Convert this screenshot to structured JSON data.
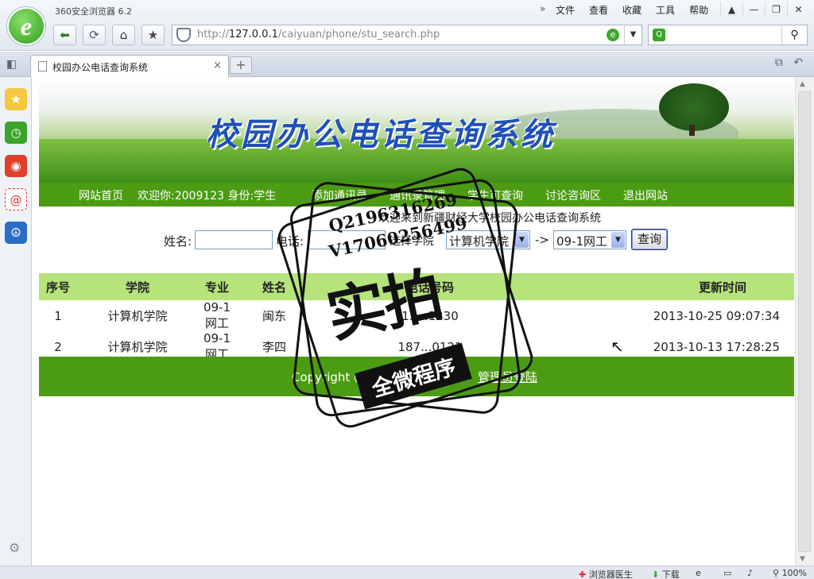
{
  "browser": {
    "app_title": "360安全浏览器 6.2",
    "logo_letter": "e",
    "menu": {
      "chevron": "»",
      "items": [
        "文件",
        "查看",
        "收藏",
        "工具",
        "帮助"
      ]
    },
    "window_buttons": [
      "▲",
      "—",
      "❐",
      "✕"
    ],
    "address": {
      "url_prefix": "http://",
      "url_host": "127.0.0.1",
      "url_path": "/caiyuan/phone/stu_search.php"
    },
    "search": {
      "value": ""
    },
    "tab": {
      "title": "校园办公电话查询系统",
      "close": "×"
    },
    "new_tab": "+",
    "status": {
      "doctor": "浏览器医生",
      "download": "下载",
      "zoom": "100%"
    }
  },
  "site": {
    "banner_title": "校园办公电话查询系统",
    "nav": [
      {
        "label": "网站首页"
      },
      {
        "label": "欢迎你:2009123 身份:学生"
      },
      {
        "label": "添加通讯录"
      },
      {
        "label": "通讯录管理"
      },
      {
        "label": "学生可查询"
      },
      {
        "label": "讨论咨询区"
      },
      {
        "label": "退出网站"
      }
    ],
    "welcome": "欢迎来到新疆财经大学校园办公电话查询系统",
    "form": {
      "name_label": "姓名:",
      "name_value": "",
      "phone_label": "电话:",
      "phone_value": "",
      "college_label": "选择学院",
      "college_selected": "计算机学院",
      "arrow": "->",
      "class_selected": "09-1网工",
      "submit": "查询"
    },
    "table": {
      "headers": [
        "序号",
        "学院",
        "专业",
        "姓名",
        "电话号码",
        "更新时间"
      ],
      "rows": [
        [
          "1",
          "计算机学院",
          "09-1网工",
          "闽东",
          "13...1230",
          "2013-10-25 09:07:34"
        ],
        [
          "2",
          "计算机学院",
          "09-1网工",
          "李四",
          "187...0121",
          "2013-10-13 17:28:25"
        ]
      ]
    },
    "footer": {
      "copyright": "Copyright @ ...大学",
      "admin_link": "管理员登陆"
    }
  },
  "watermark": {
    "qq": "Q2196316269",
    "wechat": "V17060256499",
    "big": "实拍",
    "band": "全微程序"
  },
  "colors": {
    "nav_green": "#4c9c13",
    "header_green": "#b6e37a",
    "banner_title": "#1f50b8"
  }
}
